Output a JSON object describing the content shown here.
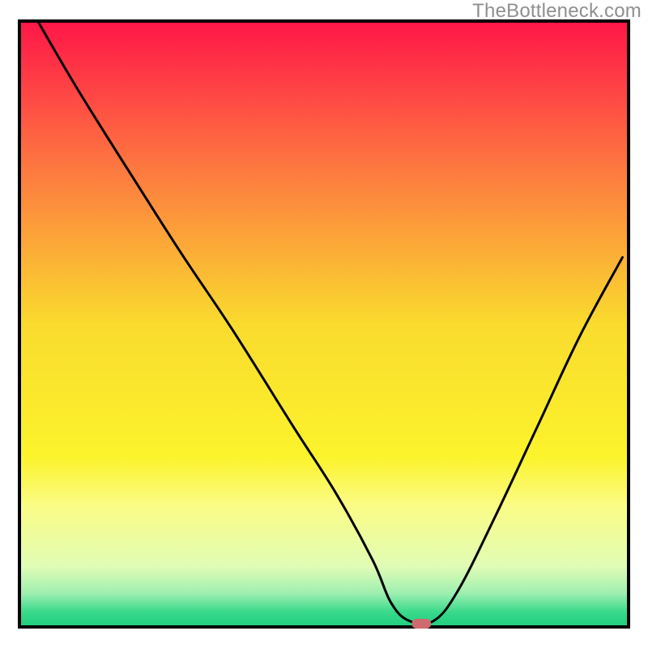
{
  "watermark": "TheBottleneck.com",
  "chart_data": {
    "type": "line",
    "title": "",
    "xlabel": "",
    "ylabel": "",
    "xlim": [
      0,
      100
    ],
    "ylim": [
      0,
      100
    ],
    "series": [
      {
        "name": "bottleneck-curve",
        "x": [
          3,
          10,
          20,
          27,
          35,
          45,
          52,
          58,
          61,
          64,
          68,
          72,
          78,
          85,
          92,
          99
        ],
        "y": [
          100,
          88,
          72,
          61,
          49,
          33,
          22,
          11,
          4,
          1,
          1,
          6,
          18,
          33,
          48,
          61
        ]
      }
    ],
    "marker": {
      "name": "optimal-point",
      "x": 66,
      "y": 0,
      "color": "#cf6a6e"
    },
    "gradient_stops": [
      {
        "offset": 0.0,
        "color": "#ff1648"
      },
      {
        "offset": 0.25,
        "color": "#fd7b40"
      },
      {
        "offset": 0.5,
        "color": "#fadb2e"
      },
      {
        "offset": 0.72,
        "color": "#fbf32c"
      },
      {
        "offset": 0.8,
        "color": "#fbfc86"
      },
      {
        "offset": 0.9,
        "color": "#e0fcb5"
      },
      {
        "offset": 0.945,
        "color": "#9defb0"
      },
      {
        "offset": 0.975,
        "color": "#3ad98b"
      },
      {
        "offset": 1.0,
        "color": "#1fce7f"
      }
    ]
  }
}
